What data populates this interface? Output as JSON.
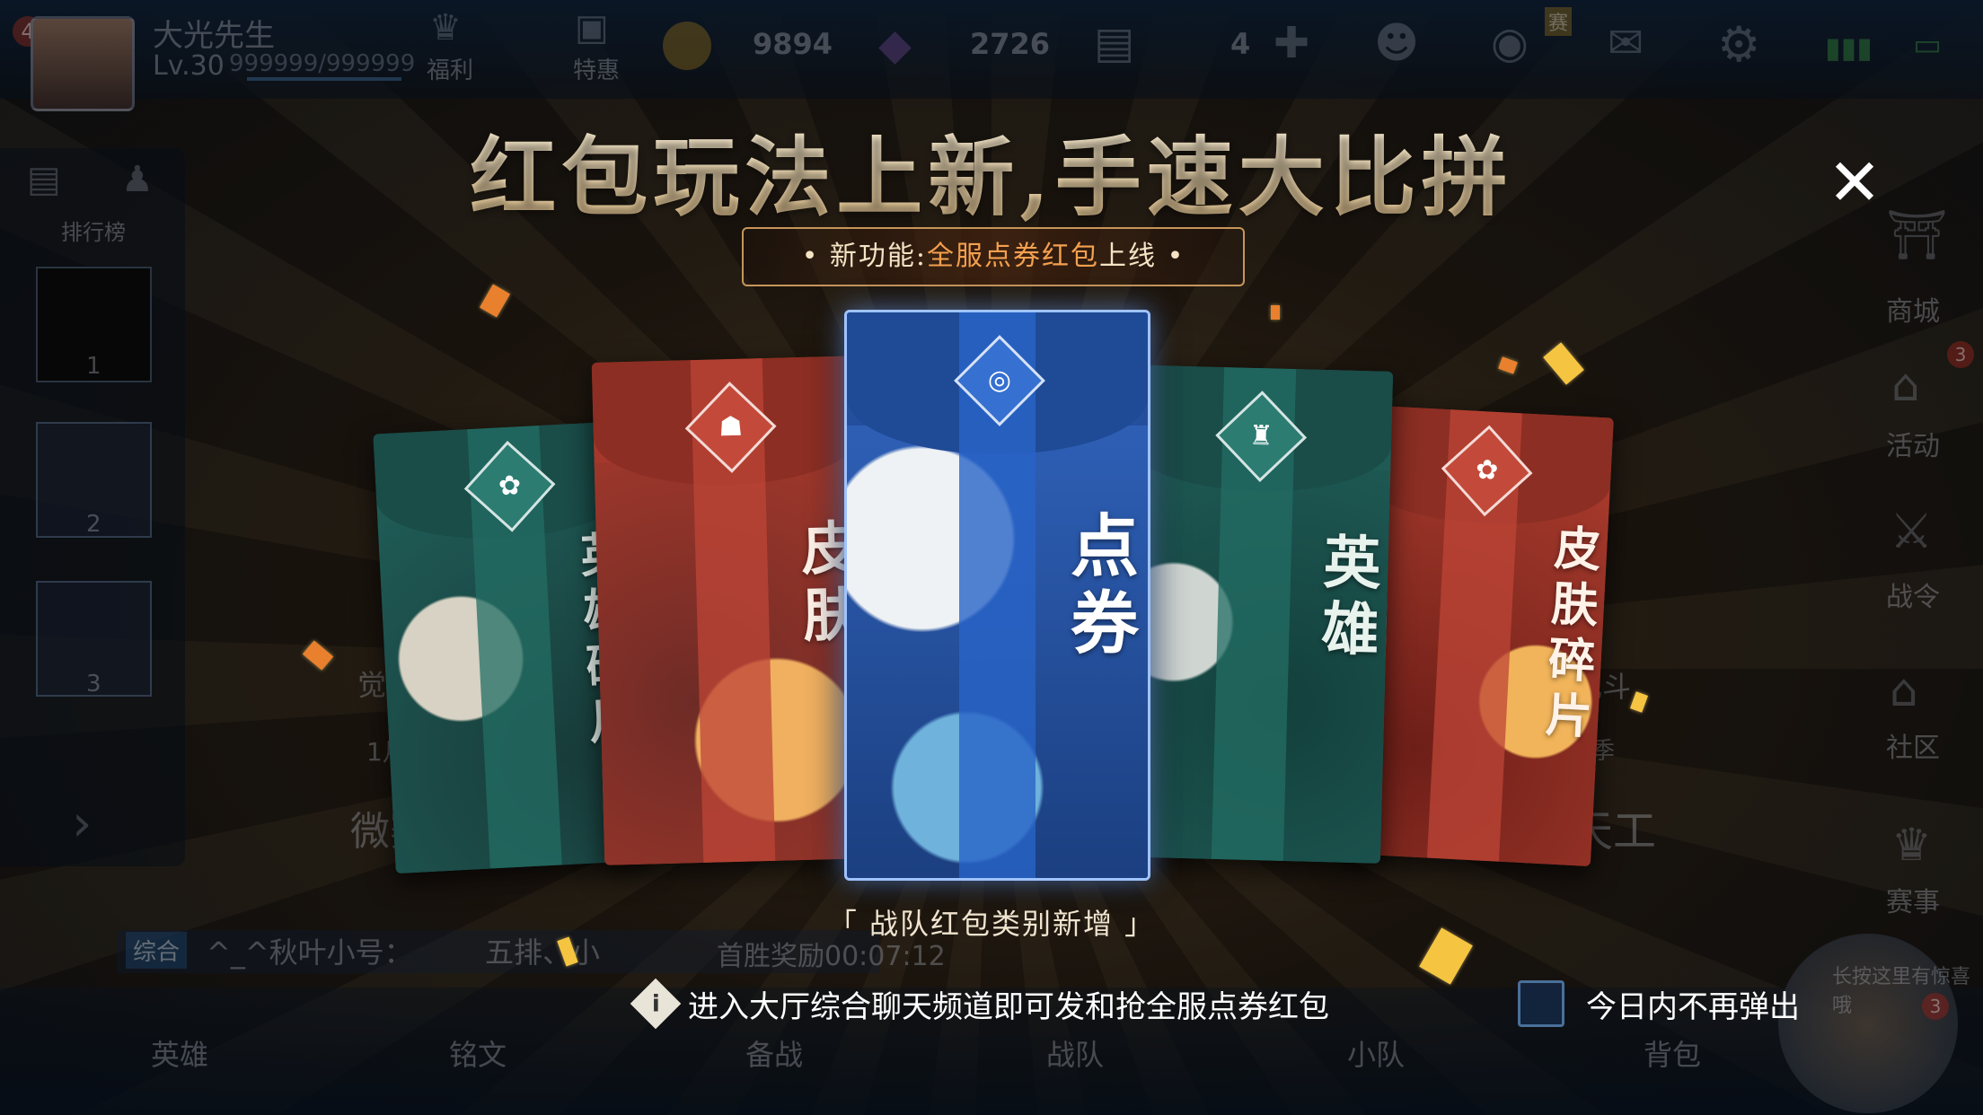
{
  "lobby": {
    "player_name": "大光先生",
    "player_level": "Lv.30",
    "exp_text": "999999/999999",
    "notification_count": "4",
    "welfare_label": "福利",
    "special_label": "特惠",
    "gold_amount": "9894",
    "diamond_amount": "2726",
    "ticket_count": "4",
    "match_badge": "赛",
    "rank_label": "排行榜",
    "rank_badges": [
      "1",
      "2",
      "3"
    ],
    "right_menu": [
      "商城",
      "活动",
      "战令",
      "社区",
      "赛事"
    ],
    "activity_badge": "3",
    "mode_texts": [
      "觉醒",
      "1月月",
      "微赛",
      "混乱斗",
      "新赛季",
      "象天工"
    ],
    "chat_channel": "综合",
    "chat_line": "^_^秋叶小号：",
    "chat_line2": "五排、小",
    "first_win_text": "首胜奖励00:07:12",
    "bottom_nav": [
      "英雄",
      "铭文",
      "备战",
      "战队",
      "小队",
      "背包"
    ],
    "assistant_text": "长按这里有惊喜哦",
    "assistant_badge": "3"
  },
  "popup": {
    "title": "红包玩法上新,手速大比拼",
    "banner_label": "• 新功能:",
    "banner_highlight": "全服点券红包",
    "banner_tail": "上线 •",
    "cards": [
      {
        "label": "英雄碎片",
        "theme": "teal",
        "icon": "✿"
      },
      {
        "label": "皮肤",
        "theme": "red",
        "icon": "☗"
      },
      {
        "label": "点券",
        "theme": "blue",
        "icon": "◎"
      },
      {
        "label": "英雄",
        "theme": "teal",
        "icon": "♜"
      },
      {
        "label": "皮肤碎片",
        "theme": "red",
        "icon": "✿"
      }
    ],
    "caption": "「 战队红包类别新增 」",
    "info_icon": "i",
    "info_text": "进入大厅综合聊天频道即可发和抢全服点券红包",
    "dont_show_label": "今日内不再弹出",
    "close_icon": "✕"
  },
  "colors": {
    "teal": "#1f5a55",
    "red": "#a3382b",
    "blue": "#244f9c",
    "gold_text": "#e6c48b",
    "highlight": "#f4a04f"
  }
}
